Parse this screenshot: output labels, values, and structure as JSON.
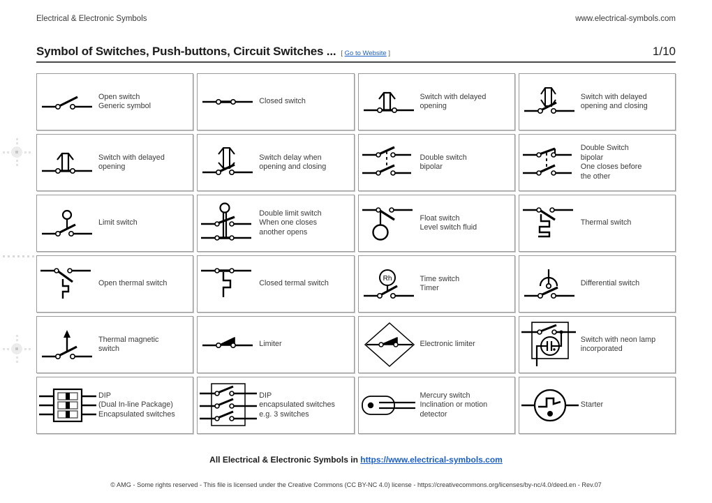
{
  "header": {
    "left_text": "Electrical & Electronic Symbols",
    "right_text": "www.electrical-symbols.com",
    "title": "Symbol of Switches, Push-buttons, Circuit Switches ...",
    "goto_open": "[",
    "goto_link": "Go to Website",
    "goto_close": "]",
    "page_number": "1/10"
  },
  "cells": [
    {
      "icon": "open-switch-symbol",
      "label": "Open switch\nGeneric symbol"
    },
    {
      "icon": "closed-switch-symbol",
      "label": "Closed switch"
    },
    {
      "icon": "switch-delayed-opening-symbol",
      "label": "Switch with delayed\nopening"
    },
    {
      "icon": "switch-delayed-opening-closing-symbol",
      "label": "Switch with delayed\nopening and closing"
    },
    {
      "icon": "switch-delayed-opening-2-symbol",
      "label": "Switch with delayed\nopening"
    },
    {
      "icon": "switch-delay-opening-closing-symbol",
      "label": "Switch delay when\nopening and closing"
    },
    {
      "icon": "double-switch-bipolar-symbol",
      "label": "Double switch\nbipolar"
    },
    {
      "icon": "double-switch-bipolar-sequence-symbol",
      "label": "Double Switch\nbipolar\nOne closes before\nthe other"
    },
    {
      "icon": "limit-switch-symbol",
      "label": "Limit switch"
    },
    {
      "icon": "double-limit-switch-symbol",
      "label": "Double limit switch\nWhen one closes\nanother opens"
    },
    {
      "icon": "float-switch-symbol",
      "label": "Float switch\nLevel switch fluid"
    },
    {
      "icon": "thermal-switch-symbol",
      "label": "Thermal switch"
    },
    {
      "icon": "open-thermal-switch-symbol",
      "label": "Open thermal switch"
    },
    {
      "icon": "closed-thermal-switch-symbol",
      "label": "Closed termal switch"
    },
    {
      "icon": "time-switch-symbol",
      "label": "Time switch\nTimer",
      "inner_text": "Rh"
    },
    {
      "icon": "differential-switch-symbol",
      "label": "Differential switch"
    },
    {
      "icon": "thermal-magnetic-switch-symbol",
      "label": "Thermal magnetic\nswitch"
    },
    {
      "icon": "limiter-symbol",
      "label": "Limiter"
    },
    {
      "icon": "electronic-limiter-symbol",
      "label": "Electronic limiter"
    },
    {
      "icon": "switch-neon-lamp-symbol",
      "label": "Switch with neon lamp\nincorporated"
    },
    {
      "icon": "dip-package-symbol",
      "label": "DIP\n(Dual In-line Package)\nEncapsulated switches"
    },
    {
      "icon": "dip-encapsulated-switches-symbol",
      "label": "DIP\nencapsulated switches\ne.g. 3 switches"
    },
    {
      "icon": "mercury-switch-symbol",
      "label": "Mercury switch\nInclination or motion\ndetector"
    },
    {
      "icon": "starter-symbol",
      "label": "Starter"
    }
  ],
  "footer": {
    "main_prefix": "All Electrical & Electronic Symbols in ",
    "main_link": "https://www.electrical-symbols.com",
    "license": "© AMG - Some rights reserved - This file is licensed under the Creative Commons (CC BY-NC 4.0) license - https://creativecommons.org/licenses/by-nc/4.0/deed.en - Rev.07"
  },
  "colors": {
    "link": "#1c5fc4",
    "text": "#3a3a3a",
    "symbol": "#000000",
    "cell_border": "#9a9a9a",
    "rule": "#4a4a4a"
  }
}
